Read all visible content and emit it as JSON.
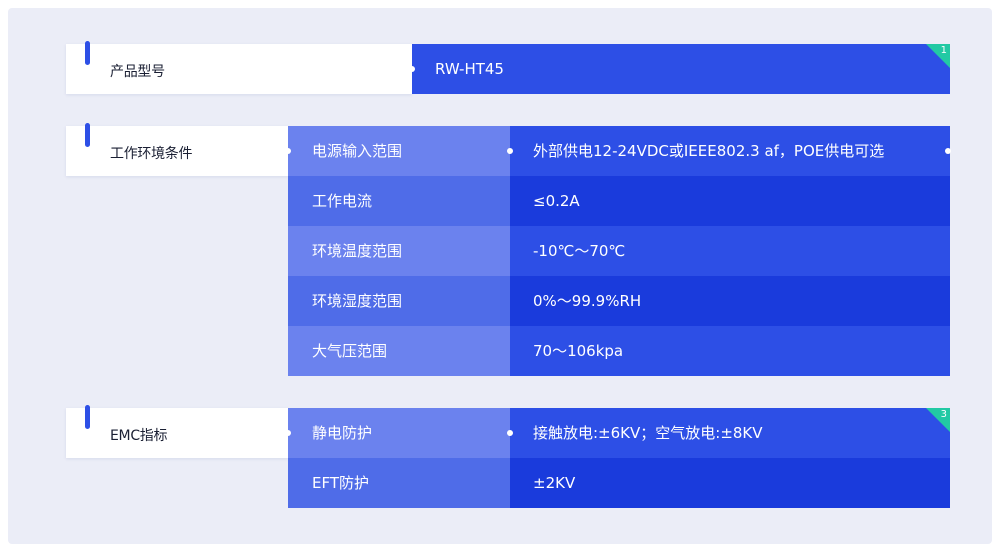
{
  "sections": [
    {
      "label": "产品型号",
      "badge": "1",
      "rows": [
        {
          "value": "RW-HT45"
        }
      ]
    },
    {
      "label": "工作环境条件",
      "rows": [
        {
          "name": "电源输入范围",
          "value": "外部供电12-24VDC或IEEE802.3 af，POE供电可选"
        },
        {
          "name": "工作电流",
          "value": "≤0.2A"
        },
        {
          "name": "环境温度范围",
          "value": "-10℃～70℃"
        },
        {
          "name": "环境湿度范围",
          "value": "0%～99.9%RH"
        },
        {
          "name": "大气压范围",
          "value": "70～106kpa"
        }
      ]
    },
    {
      "label": "EMC指标",
      "badge": "3",
      "rows": [
        {
          "name": "静电防护",
          "value": "接触放电:±6KV；空气放电:±8KV"
        },
        {
          "name": "EFT防护",
          "value": "±2KV"
        }
      ]
    }
  ],
  "colors": {
    "page_bg": "#ebedf7",
    "accent": "#2d4fe6",
    "value_dark": "#1a3bdc",
    "name_light": "#6b82ee",
    "name_mid": "#4f6ce8",
    "badge": "#22c9a4"
  }
}
